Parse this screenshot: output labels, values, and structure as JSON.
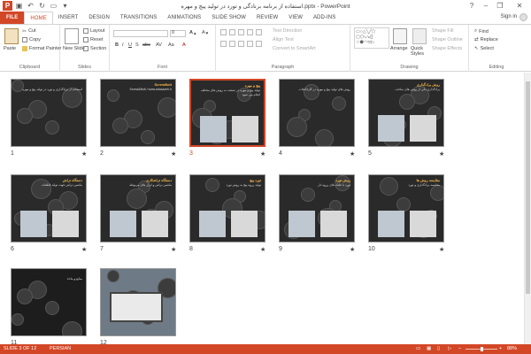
{
  "window": {
    "title": "استفاده از برنامه برنادگی و تورد در تولید پیچ و مهره.pptx - PowerPoint",
    "help": "?",
    "minimize": "–",
    "restore": "❐",
    "close": "✕",
    "sign_in": "Sign in"
  },
  "tabs": [
    "FILE",
    "HOME",
    "INSERT",
    "DESIGN",
    "TRANSITIONS",
    "ANIMATIONS",
    "SLIDE SHOW",
    "REVIEW",
    "VIEW",
    "ADD-INS"
  ],
  "ribbon": {
    "clipboard": {
      "label": "Clipboard",
      "paste": "Paste",
      "cut": "Cut",
      "copy": "Copy",
      "format_painter": "Format Painter"
    },
    "slides": {
      "label": "Slides",
      "new_slide": "New Slide",
      "layout": "Layout",
      "reset": "Reset",
      "section": "Section"
    },
    "font": {
      "label": "Font",
      "font_size": "0",
      "bold": "B",
      "italic": "I",
      "underline": "U",
      "strike": "S",
      "shadow": "abc",
      "spacing": "AV",
      "case": "Aa"
    },
    "paragraph": {
      "label": "Paragraph",
      "text_direction": "Text Direction",
      "align_text": "Align Text",
      "convert_smartart": "Convert to SmartArt"
    },
    "drawing": {
      "label": "Drawing",
      "arrange": "Arrange",
      "quick_styles": "Quick Styles",
      "shape_fill": "Shape Fill",
      "shape_outline": "Shape Outline",
      "shape_effects": "Shape Effects"
    },
    "editing": {
      "label": "Editing",
      "find": "Find",
      "replace": "Replace",
      "select": "Select"
    }
  },
  "slides": [
    {
      "num": "1",
      "star": "★",
      "title": "",
      "body": "استفاده از برادگذاری و تورد در تولید پیچ و مهره"
    },
    {
      "num": "2",
      "star": "★",
      "title": "ScrewBolt",
      "body": "Screw&Bolt / www.ariasazeh.ir"
    },
    {
      "num": "3",
      "star": "★",
      "title": "پیچ و مهره",
      "body": "تولید پیچ و مهره در صنعت به روش های مختلف انجام می شود"
    },
    {
      "num": "4",
      "star": "★",
      "title": "",
      "body": "روش های تولید پیچ و مهره در کارخانجات"
    },
    {
      "num": "5",
      "star": "★",
      "title": "روش برادگذاری",
      "body": "برادگذاری یکی از روش های ساخت"
    },
    {
      "num": "6",
      "star": "★",
      "title": "دستگاه تراش",
      "body": "ماشین تراش جهت تولید قطعات"
    },
    {
      "num": "7",
      "star": "★",
      "title": "دستگاه تراشکاری",
      "body": "ماشین تراش و ابزار های مربوطه"
    },
    {
      "num": "8",
      "star": "★",
      "title": "تورد پیچ",
      "body": "تولید رزوه پیچ به روش تورد"
    },
    {
      "num": "9",
      "star": "★",
      "title": "روش تورد",
      "body": "تورد با غلتک های رزوه دار"
    },
    {
      "num": "10",
      "star": "★",
      "title": "مقایسه روش ها",
      "body": "مقایسه برادگذاری و تورد"
    },
    {
      "num": "11",
      "star": "",
      "title": "",
      "body": "منابع و ماخذ"
    },
    {
      "num": "12",
      "star": "",
      "title": "",
      "body": ""
    }
  ],
  "status": {
    "slide_info": "SLIDE 3 OF 12",
    "language": "PERSIAN",
    "zoom": "88%"
  },
  "colors": {
    "accent": "#d24726",
    "slide_title": "#f6b94b"
  }
}
